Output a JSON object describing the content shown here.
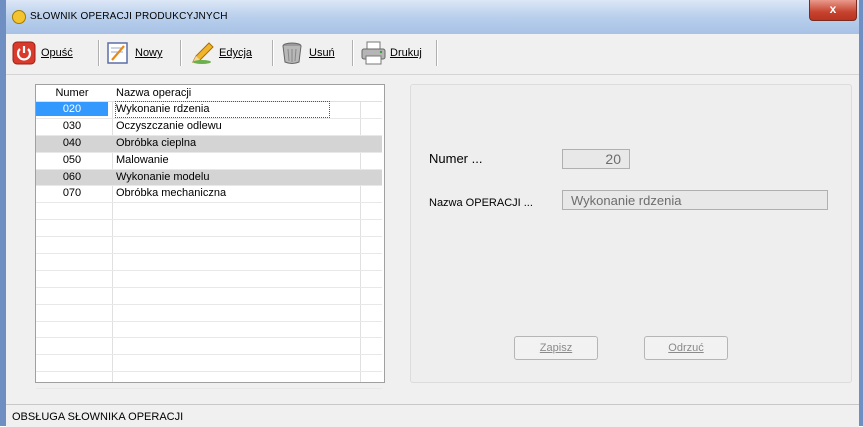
{
  "window": {
    "title": "SŁOWNIK OPERACJI PRODUKCYJNYCH",
    "close_glyph": "x",
    "close_color": "#c6432f"
  },
  "toolbar": {
    "buttons": [
      {
        "label": "Opuść",
        "icon": "power-icon"
      },
      {
        "label": "Nowy",
        "icon": "new-document-icon"
      },
      {
        "label": "Edycja",
        "icon": "pencil-icon"
      },
      {
        "label": "Usuń",
        "icon": "trash-icon"
      },
      {
        "label": "Drukuj",
        "icon": "printer-icon"
      }
    ]
  },
  "list": {
    "columns": [
      "Numer",
      "Nazwa operacji"
    ],
    "rows": [
      {
        "num": "020",
        "name": "Wykonanie rdzenia"
      },
      {
        "num": "030",
        "name": "Oczyszczanie odlewu"
      },
      {
        "num": "040",
        "name": "Obróbka cieplna"
      },
      {
        "num": "050",
        "name": "Malowanie"
      },
      {
        "num": "060",
        "name": "Wykonanie modelu"
      },
      {
        "num": "070",
        "name": "Obróbka mechaniczna"
      }
    ],
    "selected_color": "#3399ff",
    "alt_row_color": "#d4d4d4"
  },
  "detail": {
    "number_label": "Numer ...",
    "number_value": "20",
    "name_label": "Nazwa OPERACJI ...",
    "name_value": "Wykonanie rdzenia",
    "save_label": "Zapisz",
    "discard_label": "Odrzuć"
  },
  "status": {
    "text": "OBSŁUGA SŁOWNIKA OPERACJI"
  }
}
